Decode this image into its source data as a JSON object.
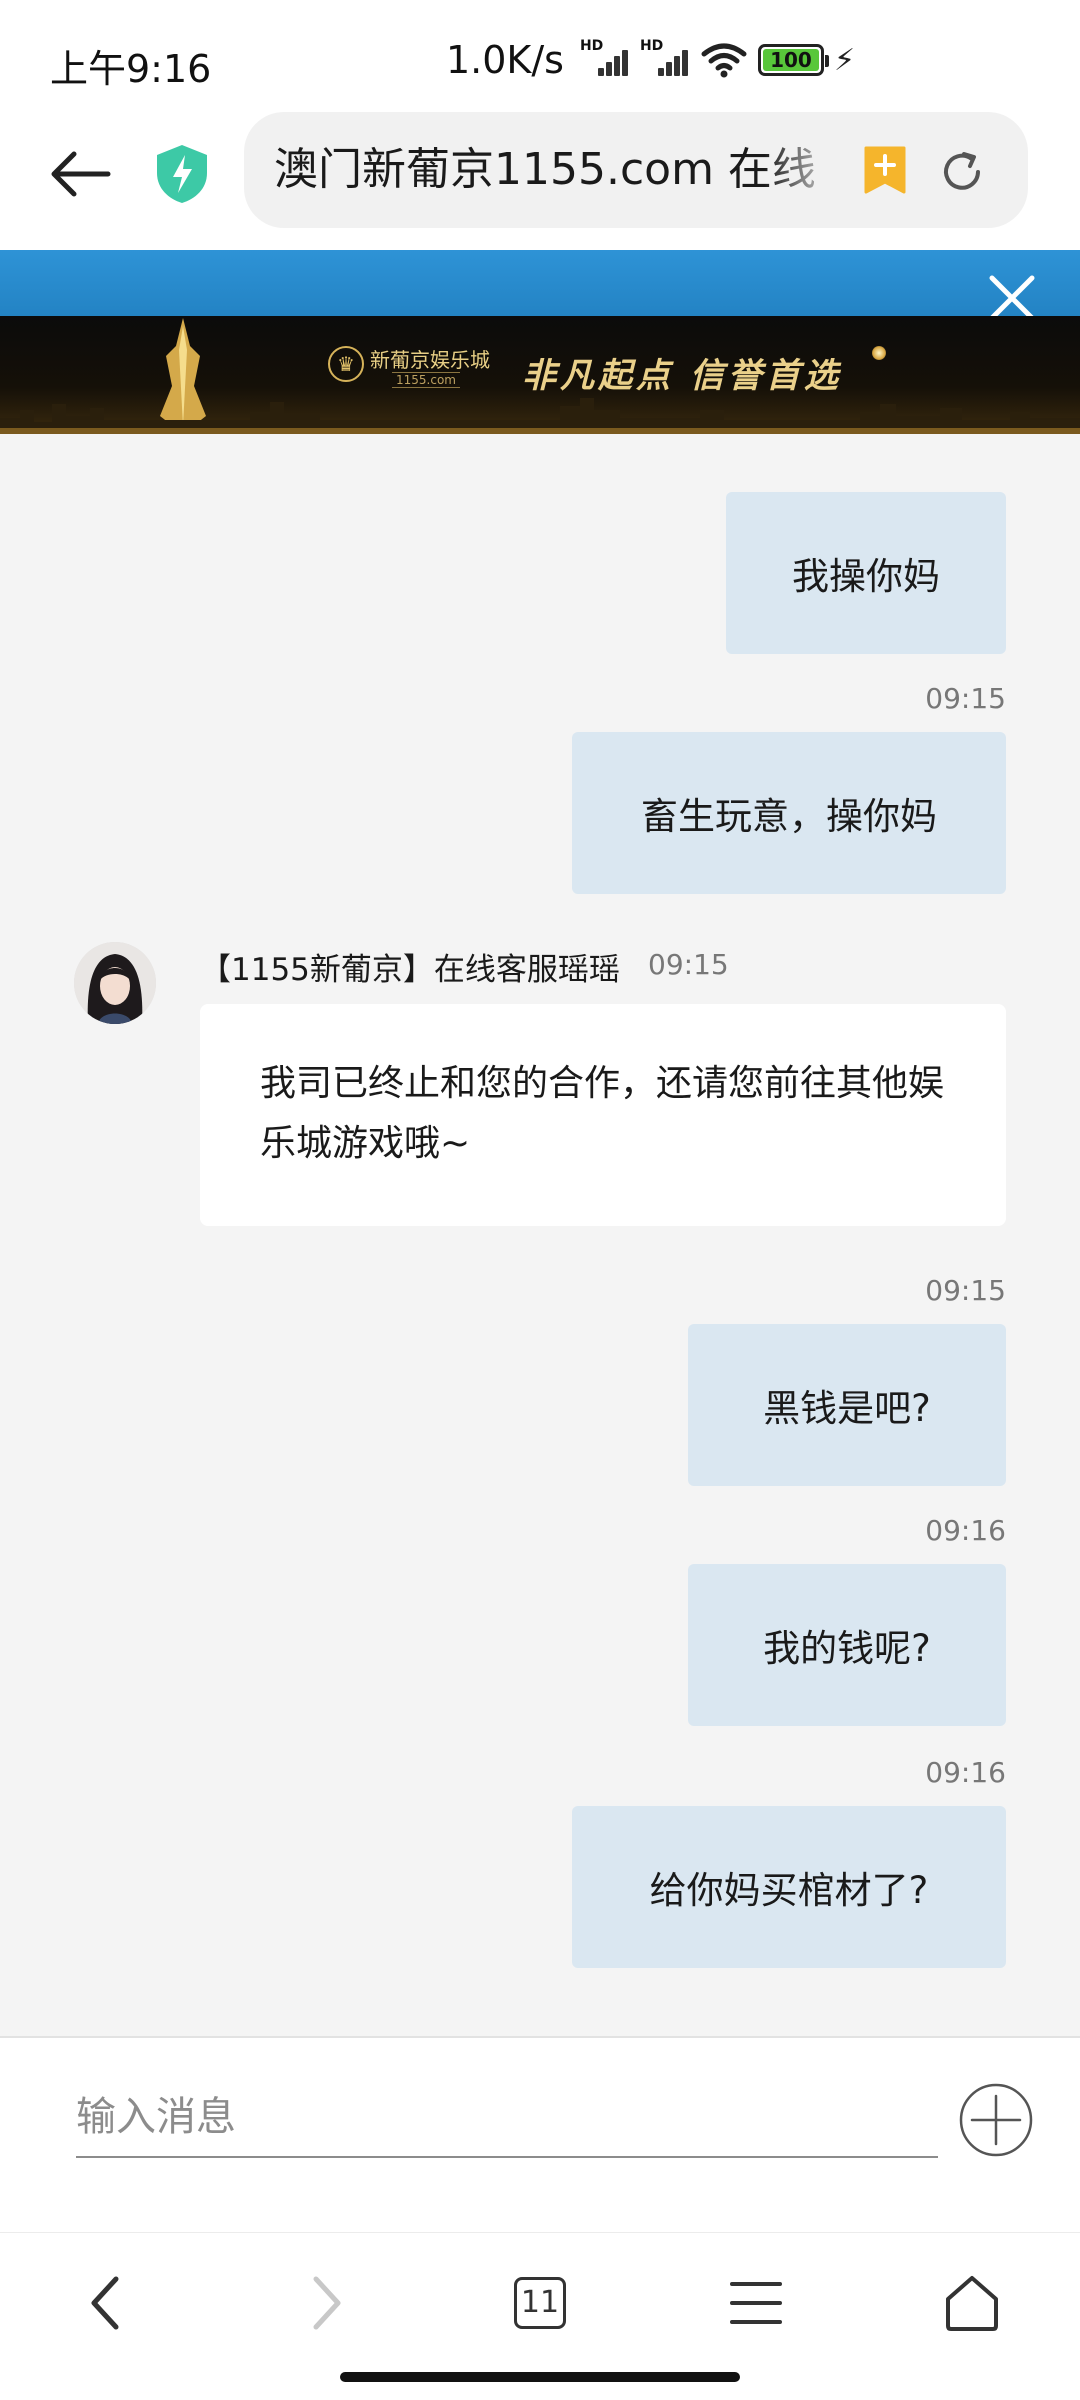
{
  "status_bar": {
    "time": "上午9:16",
    "net_speed": "1.0K/s",
    "signal_label": "HD",
    "battery": "100"
  },
  "browser": {
    "url_text": "澳门新葡京1155.com 在线"
  },
  "banner": {
    "brand_name": "新葡京娱乐城",
    "brand_domain": "1155.com",
    "slogan": "非凡起点 信誉首选",
    "colors": {
      "top_band": "#2383c4",
      "gold": "#ead08a"
    }
  },
  "chat": {
    "messages_before": [
      {
        "text": "我操你妈"
      },
      {
        "time": "09:15",
        "text": "畜生玩意，操你妈"
      }
    ],
    "agent": {
      "name": "【1155新葡京】在线客服瑶瑶",
      "time": "09:15",
      "text": "我司已终止和您的合作，还请您前往其他娱乐城游戏哦~"
    },
    "messages_after": [
      {
        "time": "09:15",
        "text": "黑钱是吧?"
      },
      {
        "time": "09:16",
        "text": "我的钱呢?"
      },
      {
        "time": "09:16",
        "text": "给你妈买棺材了?"
      }
    ],
    "colors": {
      "outgoing_bubble": "#dae7f1",
      "incoming_bubble": "#ffffff",
      "background": "#f4f4f4"
    }
  },
  "input": {
    "placeholder": "输入消息"
  },
  "nav": {
    "tab_count": "11"
  }
}
